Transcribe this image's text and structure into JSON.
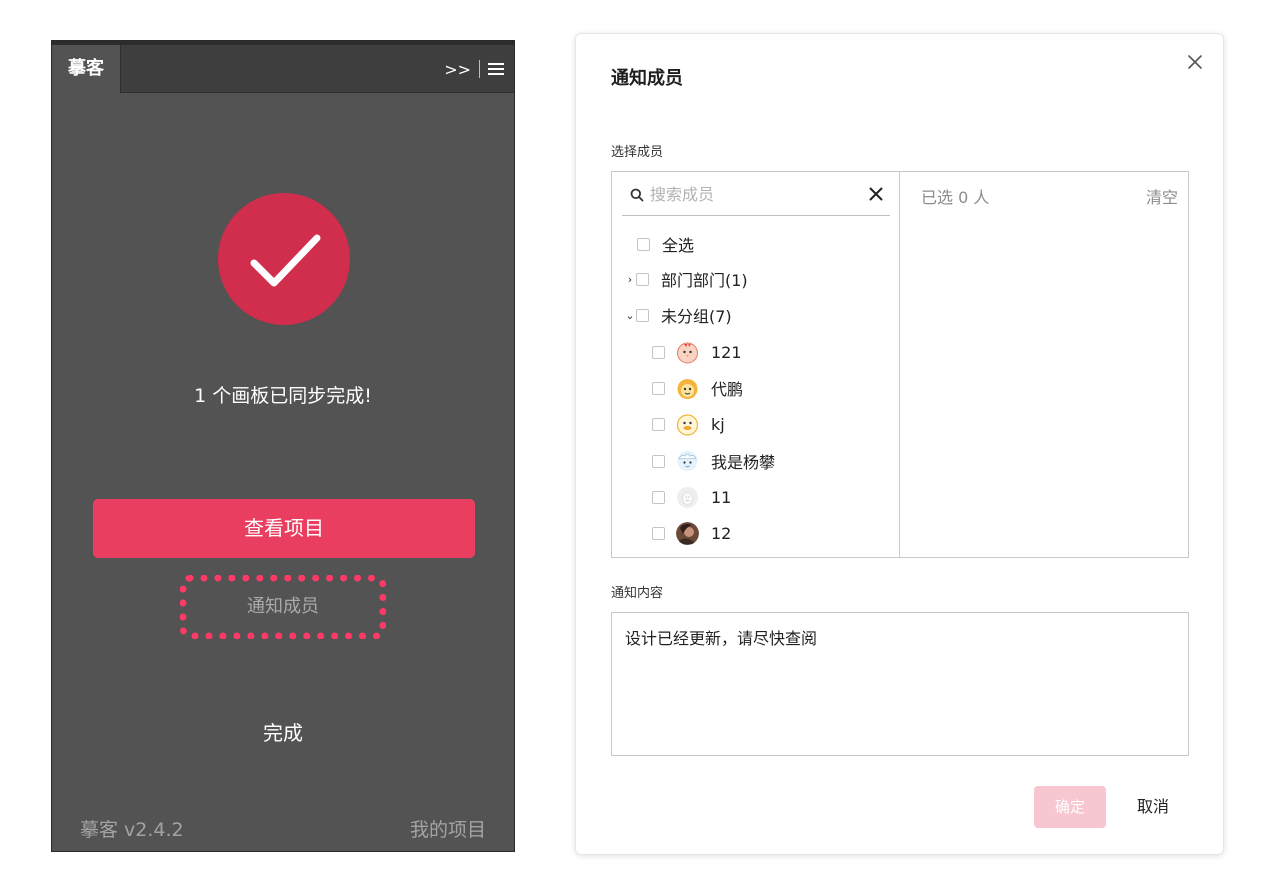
{
  "panel": {
    "tab_title": "摹客",
    "expand_icon": ">>",
    "success_message": "1 个画板已同步完成!",
    "view_project_label": "查看项目",
    "notify_members_label": "通知成员",
    "done_label": "完成",
    "version": "摹客 v2.4.2",
    "my_projects_label": "我的项目",
    "colors": {
      "background": "#535353",
      "accent": "#ea3e61",
      "success": "#d12d4d",
      "highlight": "#ff3a66"
    }
  },
  "dialog": {
    "title": "通知成员",
    "select_members_label": "选择成员",
    "search": {
      "placeholder": "搜索成员"
    },
    "select_all_label": "全选",
    "groups": [
      {
        "label": "部门部门(1)",
        "expanded": false
      },
      {
        "label": "未分组(7)",
        "expanded": true
      }
    ],
    "members": [
      {
        "name": "121",
        "avatar": "chicken-avatar"
      },
      {
        "name": "代鹏",
        "avatar": "monkey-avatar"
      },
      {
        "name": "kj",
        "avatar": "duck-avatar"
      },
      {
        "name": "我是杨攀",
        "avatar": "sheep-avatar"
      },
      {
        "name": "11",
        "avatar": "egg-avatar"
      },
      {
        "name": "12",
        "avatar": "photo-avatar"
      }
    ],
    "selected_count_label": "已选 0 人",
    "clear_label": "清空",
    "content_label": "通知内容",
    "content_text": "设计已经更新，请尽快查阅",
    "confirm_label": "确定",
    "cancel_label": "取消",
    "colors": {
      "confirm_disabled": "#f7c6d1"
    }
  }
}
